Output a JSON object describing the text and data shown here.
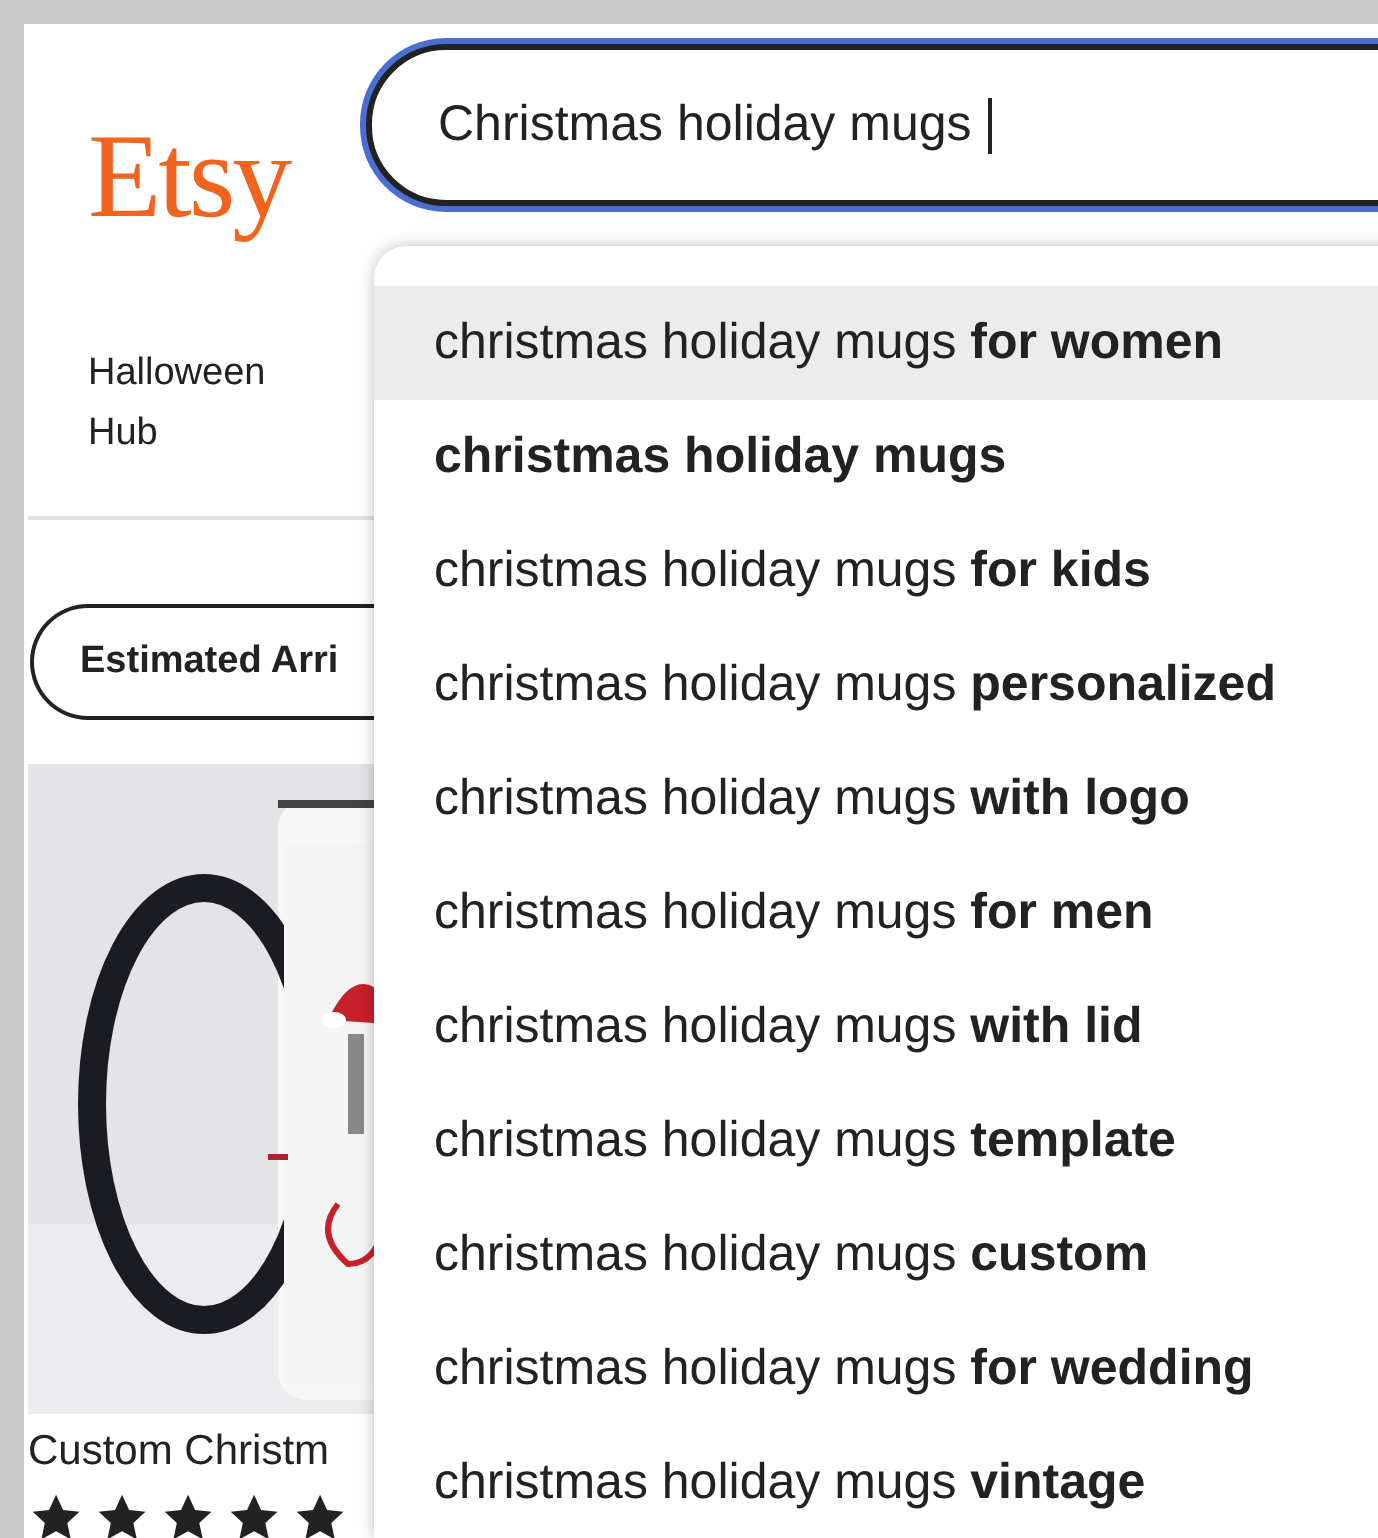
{
  "logo": "Etsy",
  "search": {
    "value": "Christmas holiday mugs"
  },
  "nav": {
    "label": "Halloween Hub"
  },
  "filter": {
    "label": "Estimated Arri"
  },
  "product": {
    "kind": "picture",
    "title": "Custom Christm",
    "stars": 5
  },
  "suggestions": [
    {
      "kind": "completion",
      "text": "christmas holiday mugs **for women**",
      "selected": true
    },
    {
      "kind": "exact",
      "text": "christmas holiday mugs",
      "selected": false
    },
    {
      "kind": "completion",
      "text": "christmas holiday mugs **for kids**",
      "selected": false
    },
    {
      "kind": "completion",
      "text": "christmas holiday mugs **personalized**",
      "selected": false
    },
    {
      "kind": "completion",
      "text": "christmas holiday mugs **with logo**",
      "selected": false
    },
    {
      "kind": "completion",
      "text": "christmas holiday mugs **for men**",
      "selected": false
    },
    {
      "kind": "completion",
      "text": "christmas holiday mugs **with lid**",
      "selected": false
    },
    {
      "kind": "completion",
      "text": "christmas holiday mugs **template**",
      "selected": false
    },
    {
      "kind": "completion",
      "text": "christmas holiday mugs **custom**",
      "selected": false
    },
    {
      "kind": "completion",
      "text": "christmas holiday mugs **for wedding**",
      "selected": false
    },
    {
      "kind": "completion",
      "text": "christmas holiday mugs **vintage**",
      "selected": false
    }
  ]
}
